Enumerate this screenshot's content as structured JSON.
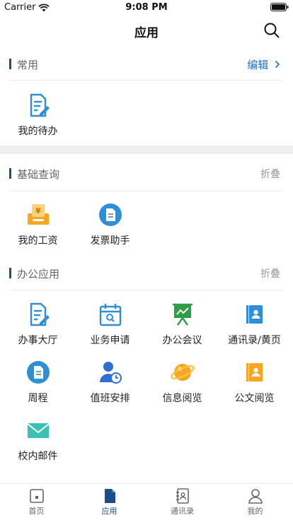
{
  "status_bar": {
    "carrier": "Carrier",
    "time": "9:08 PM"
  },
  "nav": {
    "title": "应用"
  },
  "sections": {
    "common": {
      "title": "常用",
      "action": "编辑",
      "items": [
        "我的待办"
      ]
    },
    "basic": {
      "title": "基础查询",
      "action": "折叠",
      "items": [
        "我的工资",
        "发票助手"
      ]
    },
    "office": {
      "title": "办公应用",
      "action": "折叠",
      "items": [
        "办事大厅",
        "业务申请",
        "办公会议",
        "通讯录/黄页",
        "周程",
        "值班安排",
        "信息阅览",
        "公文阅览",
        "校内邮件"
      ]
    }
  },
  "tabs": [
    "首页",
    "应用",
    "通讯录",
    "我的"
  ],
  "colors": {
    "accent": "#1f4b86",
    "edit_blue": "#1f6fc5"
  }
}
